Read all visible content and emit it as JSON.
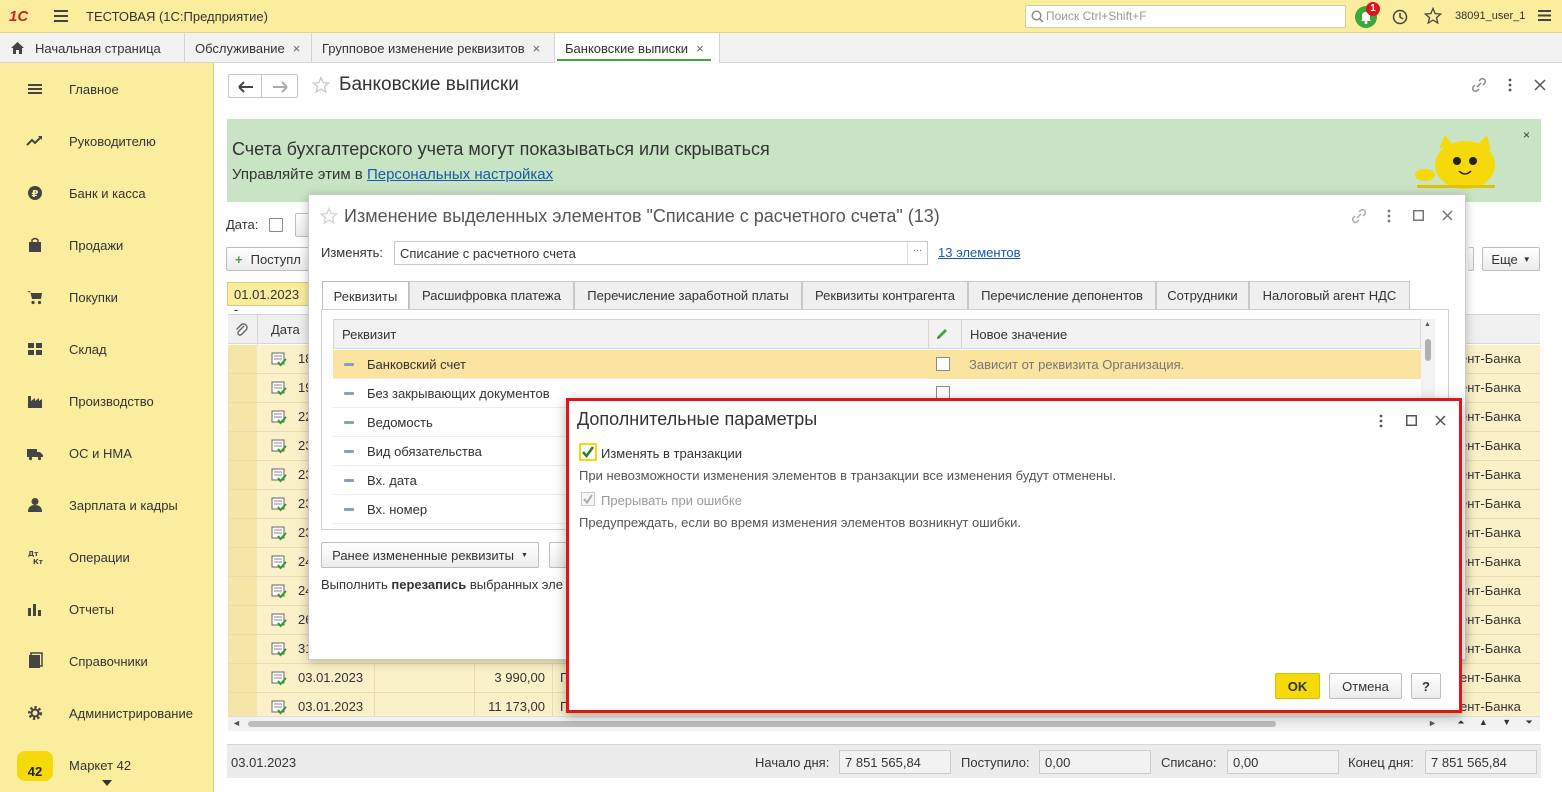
{
  "topbar": {
    "logo": "1С",
    "app_title": "ТЕСТОВАЯ  (1С:Предприятие)",
    "search_placeholder": "Поиск Ctrl+Shift+F",
    "notif_count": "1",
    "user": "38091_user_1"
  },
  "tabs": [
    "Начальная страница",
    "Обслуживание",
    "Групповое изменение реквизитов",
    "Банковские выписки"
  ],
  "sidebar": {
    "items": [
      "Главное",
      "Руководителю",
      "Банк и касса",
      "Продажи",
      "Покупки",
      "Склад",
      "Производство",
      "ОС и НМА",
      "Зарплата и кадры",
      "Операции",
      "Отчеты",
      "Справочники",
      "Администрирование",
      "Маркет 42"
    ],
    "market_badge": "42"
  },
  "page": {
    "title": "Банковские выписки"
  },
  "banner": {
    "line1": "Счета бухгалтерского учета могут показываться или скрываться",
    "line2_prefix": "Управляйте этим в ",
    "line2_link": "Персональных настройках"
  },
  "filters": {
    "date_label": "Дата:",
    "add_button": "Поступл",
    "period": "01.01.2023 -",
    "more_button": "Еще"
  },
  "grid": {
    "col_date": "Дата",
    "rows": [
      {
        "date": "18",
        "bank": "ент-Банка"
      },
      {
        "date": "19",
        "bank": "ент-Банка"
      },
      {
        "date": "22",
        "bank": "ент-Банка"
      },
      {
        "date": "23",
        "bank": "ент-Банка"
      },
      {
        "date": "23",
        "bank": "ент-Банка"
      },
      {
        "date": "23",
        "bank": "ент-Банка"
      },
      {
        "date": "23",
        "bank": "ент-Банка"
      },
      {
        "date": "24",
        "bank": "ент-Банка"
      },
      {
        "date": "24",
        "bank": "ент-Банка"
      },
      {
        "date": "26",
        "bank": "ент-Банка"
      },
      {
        "date": "31",
        "bank": "ент-Банка"
      },
      {
        "date": "03.01.2023",
        "amount": "3 990,00",
        "extra": "П",
        "bank": "ент-Банка"
      },
      {
        "date": "03.01.2023",
        "amount": "11 173,00",
        "extra": "П",
        "bank": "ент-Банка"
      }
    ]
  },
  "footer": {
    "date": "03.01.2023",
    "start_label": "Начало дня:",
    "start_value": "7 851 565,84",
    "in_label": "Поступило:",
    "in_value": "0,00",
    "out_label": "Списано:",
    "out_value": "0,00",
    "end_label": "Конец дня:",
    "end_value": "7 851 565,84"
  },
  "change_dialog": {
    "title": "Изменение выделенных элементов \"Списание с расчетного счета\" (13)",
    "change_label": "Изменять:",
    "change_value": "Списание с расчетного счета",
    "count_link": "13 элементов",
    "tabs": [
      "Реквизиты",
      "Расшифровка платежа",
      "Перечисление заработной платы",
      "Реквизиты контрагента",
      "Перечисление депонентов",
      "Сотрудники",
      "Налоговый агент НДС"
    ],
    "col_attr": "Реквизит",
    "col_value": "Новое значение",
    "rows": [
      "Банковский счет",
      "Без закрывающих документов",
      "Ведомость",
      "Вид обязательства",
      "Вх. дата",
      "Вх. номер"
    ],
    "first_row_value": "Зависит от реквизита Организация.",
    "prev_button": "Ранее измененные реквизиты",
    "exec_prefix": "Выполнить ",
    "exec_bold": "перезапись",
    "exec_suffix": " выбранных эле"
  },
  "params_dialog": {
    "title": "Дополнительные параметры",
    "opt1_label": "Изменять в транзакции",
    "opt1_hint": "При невозможности изменения элементов в транзакции все изменения будут отменены.",
    "opt2_label": "Прерывать при ошибке",
    "opt2_hint": "Предупреждать, если во время изменения элементов возникнут ошибки.",
    "ok": "OK",
    "cancel": "Отмена",
    "help": "?"
  },
  "colors": {
    "brand_yellow": "#fbed9e",
    "accent_red": "#e0151c",
    "ok_yellow": "#f5d90a",
    "banner_green": "#c9e4c5",
    "link": "#1a5aa8"
  }
}
